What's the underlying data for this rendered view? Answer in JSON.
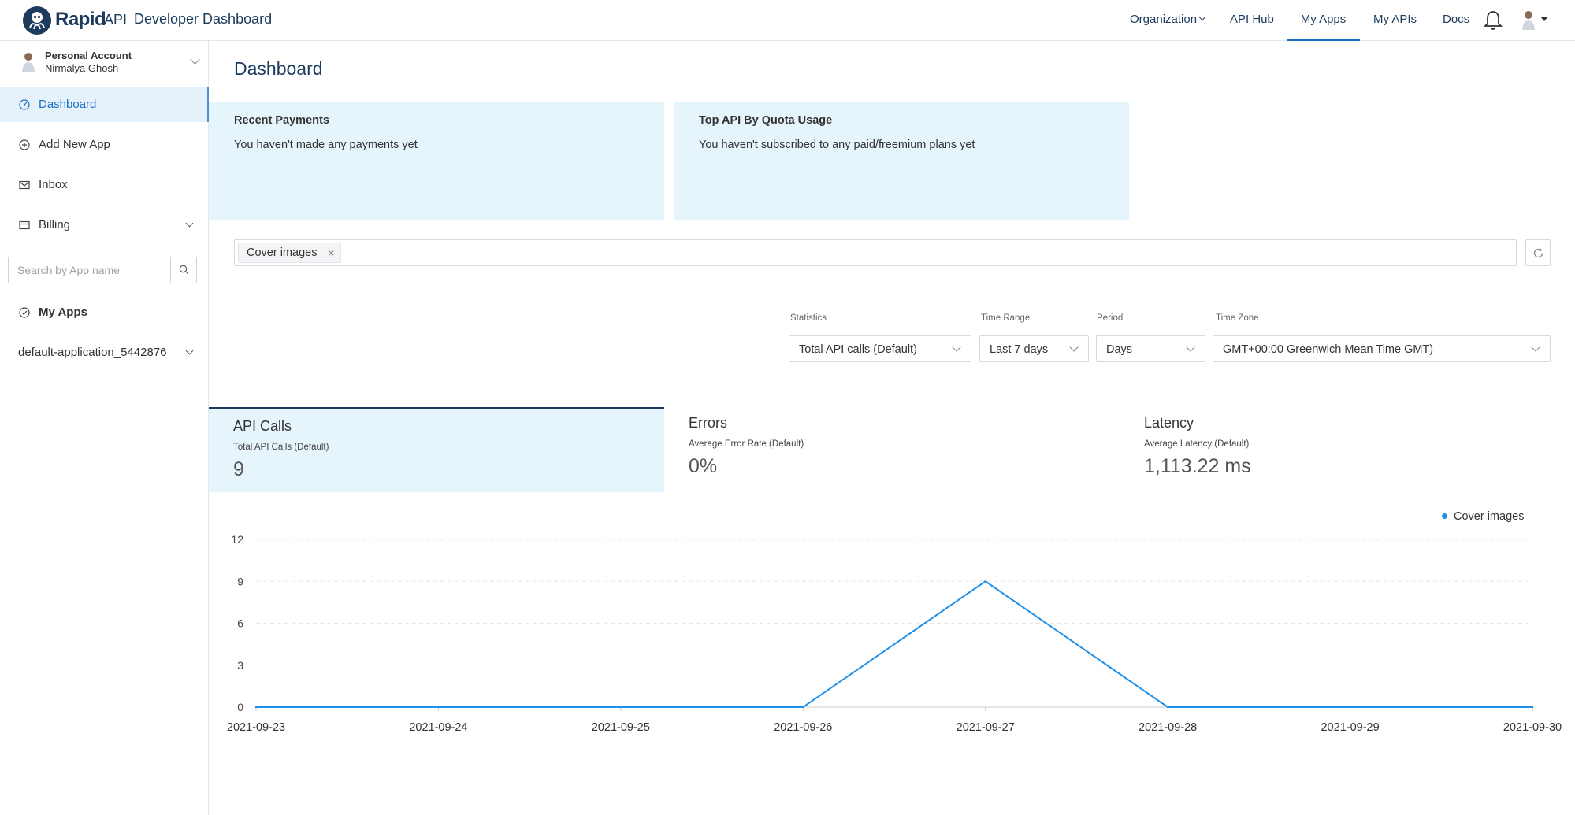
{
  "topbar": {
    "brand": "Rapid",
    "brand_suffix": "API",
    "title": "Developer Dashboard",
    "nav": {
      "organization": "Organization",
      "api_hub": "API Hub",
      "my_apps": "My Apps",
      "my_apis": "My APIs",
      "docs": "Docs"
    },
    "icons": [
      "bell-icon",
      "user-avatar",
      "caret-down-icon"
    ]
  },
  "sidebar": {
    "account": {
      "type": "Personal Account",
      "name": "Nirmalya Ghosh"
    },
    "items": [
      {
        "label": "Dashboard",
        "icon": "dashboard-icon",
        "active": true
      },
      {
        "label": "Add New App",
        "icon": "plus-circle-icon"
      },
      {
        "label": "Inbox",
        "icon": "mail-icon"
      },
      {
        "label": "Billing",
        "icon": "credit-card-icon"
      }
    ],
    "search": {
      "placeholder": "Search by App name"
    },
    "my_apps_label": "My Apps",
    "app_name": "default-application_5442876"
  },
  "main": {
    "title": "Dashboard",
    "cards": [
      {
        "title": "Recent Payments",
        "text": "You haven't made any payments yet"
      },
      {
        "title": "Top API By Quota Usage",
        "text": "You haven't subscribed to any paid/freemium plans yet"
      }
    ],
    "tags": [
      "Cover images"
    ],
    "filters": {
      "statistics": {
        "label": "Statistics",
        "value": "Total API calls (Default)"
      },
      "time_range": {
        "label": "Time Range",
        "value": "Last 7 days"
      },
      "period": {
        "label": "Period",
        "value": "Days"
      },
      "time_zone": {
        "label": "Time Zone",
        "value": "GMT+00:00 Greenwich Mean Time GMT)"
      }
    },
    "metrics": [
      {
        "title": "API Calls",
        "subtitle": "Total API Calls (Default)",
        "value": "9",
        "active": true
      },
      {
        "title": "Errors",
        "subtitle": "Average Error Rate (Default)",
        "value": "0%"
      },
      {
        "title": "Latency",
        "subtitle": "Average Latency (Default)",
        "value": "1,113.22 ms"
      }
    ]
  },
  "chart_data": {
    "type": "line",
    "x": [
      "2021-09-23",
      "2021-09-24",
      "2021-09-25",
      "2021-09-26",
      "2021-09-27",
      "2021-09-28",
      "2021-09-29",
      "2021-09-30"
    ],
    "series": [
      {
        "name": "Cover images",
        "values": [
          0,
          0,
          0,
          0,
          9,
          0,
          0,
          0
        ],
        "color": "#1f8fe8"
      }
    ],
    "yticks": [
      0,
      3,
      6,
      9,
      12
    ],
    "ylim": [
      0,
      12
    ],
    "grid": "horizontal dashed",
    "legend": "top-right",
    "title": "",
    "xlabel": "",
    "ylabel": ""
  }
}
